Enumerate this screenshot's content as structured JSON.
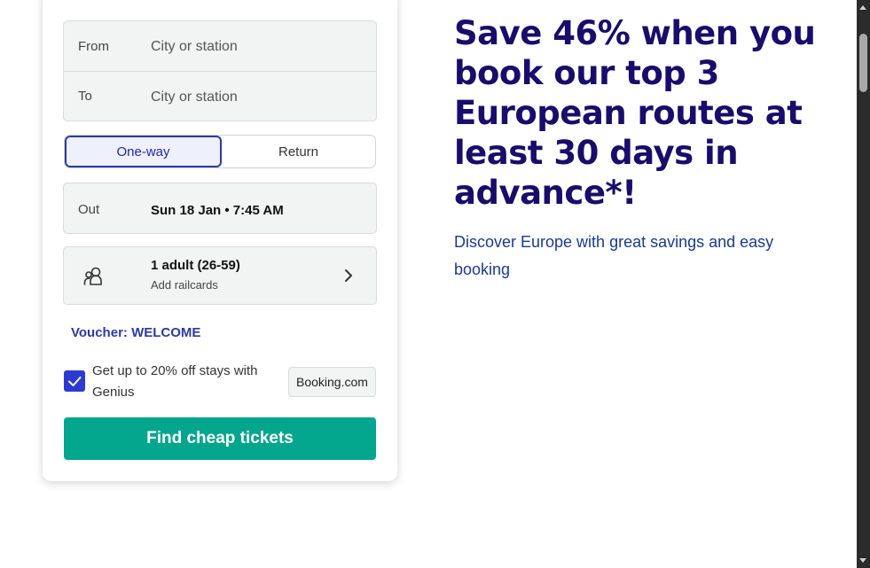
{
  "search": {
    "from": {
      "label": "From",
      "placeholder": "City or station"
    },
    "to": {
      "label": "To",
      "placeholder": "City or station"
    },
    "trip_type": {
      "options": [
        "One-way",
        "Return"
      ],
      "selected": "One-way"
    },
    "outbound": {
      "label": "Out",
      "value": "Sun 18 Jan • 7:45 AM"
    },
    "passengers": {
      "summary": "1 adult (26-59)",
      "railcards_link": "Add railcards",
      "icon": "passenger-icon"
    },
    "voucher": "Voucher: WELCOME",
    "genius": {
      "checked": true,
      "text": "Get up to 20% off stays with Genius",
      "partner": "Booking.com"
    },
    "submit_label": "Find cheap tickets"
  },
  "promo": {
    "headline": "Save 46% when you book our top 3 European routes at least 30 days in advance*!",
    "subtext": "Discover Europe with great savings and easy booking"
  },
  "colors": {
    "accent": "#2d3a9f",
    "headline": "#180d6a",
    "cta": "#02a68c",
    "checkbox": "#2d3ad0"
  }
}
